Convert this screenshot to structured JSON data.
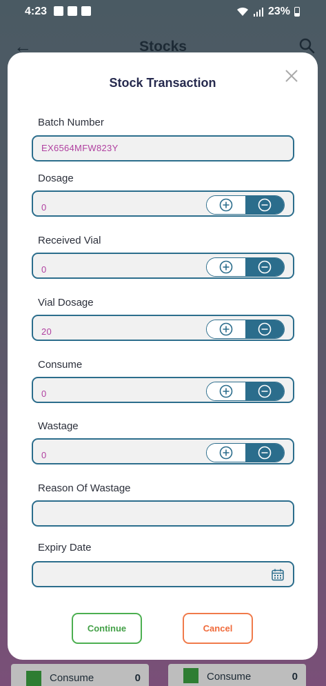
{
  "status_bar": {
    "time": "4:23",
    "battery": "23%"
  },
  "app_bar": {
    "title": "Stocks"
  },
  "background_cards": [
    {
      "label": "Consume",
      "count": "0"
    },
    {
      "label": "Consume",
      "count": "0"
    }
  ],
  "modal": {
    "title": "Stock Transaction",
    "fields": {
      "batch_number": {
        "label": "Batch Number",
        "value": "EX6564MFW823Y"
      },
      "dosage": {
        "label": "Dosage",
        "value": "0"
      },
      "received_vial": {
        "label": "Received Vial",
        "value": "0"
      },
      "vial_dosage": {
        "label": "Vial Dosage",
        "value": "20"
      },
      "consume": {
        "label": "Consume",
        "value": "0"
      },
      "wastage": {
        "label": "Wastage",
        "value": "0"
      },
      "reason_of_wastage": {
        "label": "Reason Of Wastage",
        "value": ""
      },
      "expiry_date": {
        "label": "Expiry Date",
        "value": ""
      }
    },
    "buttons": {
      "continue": "Continue",
      "cancel": "Cancel"
    }
  },
  "colors": {
    "accent": "#2b6d8c",
    "value_text": "#b040a0",
    "continue": "#4caf50",
    "cancel": "#f07a4a"
  },
  "icons": [
    "back-arrow-icon",
    "search-icon",
    "close-icon",
    "plus-circle-icon",
    "minus-circle-icon",
    "calendar-icon"
  ]
}
